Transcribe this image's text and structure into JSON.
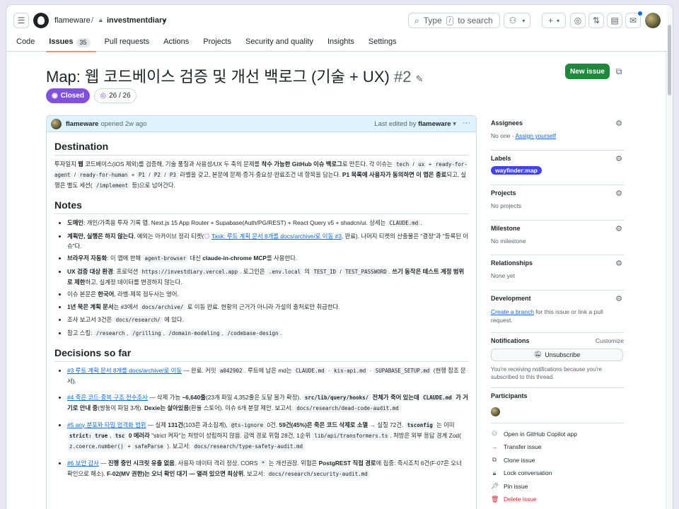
{
  "header": {
    "owner": "flameware",
    "repo": "investmentdiary",
    "search_placeholder": "Type",
    "search_key": "/",
    "search_suffix": "to search"
  },
  "tabs": [
    {
      "label": "Code"
    },
    {
      "label": "Issues",
      "count": "35"
    },
    {
      "label": "Pull requests"
    },
    {
      "label": "Actions"
    },
    {
      "label": "Projects"
    },
    {
      "label": "Security and quality"
    },
    {
      "label": "Insights"
    },
    {
      "label": "Settings"
    }
  ],
  "issue": {
    "title": "Map: 웹 코드베이스 검증 및 개선 백로그 (기술 + UX)",
    "number": "#2",
    "new_issue": "New issue",
    "state": "Closed",
    "progress": "26 / 26"
  },
  "comment": {
    "author": "flameware",
    "opened": "opened 2w ago",
    "edited_prefix": "Last edited by",
    "edited_by": "flameware"
  },
  "body": {
    "h_destination": "Destination",
    "h_notes": "Notes",
    "h_decisions": "Decisions so far"
  },
  "sidebar": {
    "assignees": {
      "title": "Assignees",
      "value": "No one - ",
      "link": "Assign yourself"
    },
    "labels": {
      "title": "Labels",
      "label": "wayfinder:map"
    },
    "projects": {
      "title": "Projects",
      "value": "No projects"
    },
    "milestone": {
      "title": "Milestone",
      "value": "No milestone"
    },
    "relationships": {
      "title": "Relationships",
      "value": "None yet"
    },
    "development": {
      "title": "Development",
      "link": "Create a branch",
      "value": " for this issue or link a pull request."
    },
    "notifications": {
      "title": "Notifications",
      "customize": "Customize",
      "button": "Unsubscribe",
      "note": "You're receiving notifications because you're subscribed to this thread."
    },
    "participants": {
      "title": "Participants"
    },
    "actions": [
      {
        "label": "Open in GitHub Copilot app",
        "icon": "copilot-icon"
      },
      {
        "label": "Transfer issue",
        "icon": "transfer-icon"
      },
      {
        "label": "Clone issue",
        "icon": "copy-icon"
      },
      {
        "label": "Lock conversation",
        "icon": "lock-icon"
      },
      {
        "label": "Pin issue",
        "icon": "pin-icon"
      },
      {
        "label": "Delete issue",
        "icon": "trash-icon",
        "color": "#d1242f"
      }
    ]
  },
  "colors": {
    "closed": "#8250df",
    "new_issue": "#1f883d",
    "label": "#4142f5",
    "link": "#0969da"
  }
}
